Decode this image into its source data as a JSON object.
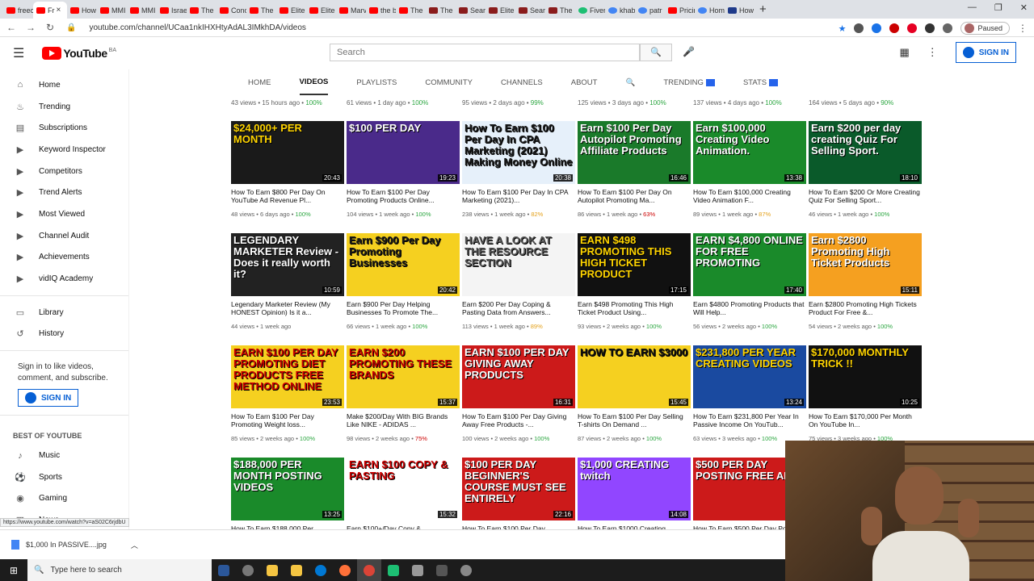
{
  "browser": {
    "tabs": [
      {
        "label": "freec",
        "icon": "youtube-icon",
        "active": false
      },
      {
        "label": "Fr",
        "icon": "youtube-icon",
        "active": true
      },
      {
        "label": "How",
        "icon": "youtube-icon",
        "active": false
      },
      {
        "label": "MMI",
        "icon": "youtube-icon",
        "active": false
      },
      {
        "label": "MMI",
        "icon": "youtube-icon",
        "active": false
      },
      {
        "label": "Israe",
        "icon": "youtube-icon",
        "active": false
      },
      {
        "label": "The",
        "icon": "youtube-icon",
        "active": false
      },
      {
        "label": "Conc",
        "icon": "youtube-icon",
        "active": false
      },
      {
        "label": "The",
        "icon": "youtube-icon",
        "active": false
      },
      {
        "label": "Elite",
        "icon": "youtube-icon",
        "active": false
      },
      {
        "label": "Elite",
        "icon": "youtube-icon",
        "active": false
      },
      {
        "label": "Marv",
        "icon": "youtube-icon",
        "active": false
      },
      {
        "label": "the b",
        "icon": "youtube-icon",
        "active": false
      },
      {
        "label": "The",
        "icon": "youtube-icon",
        "active": false
      },
      {
        "label": "The",
        "icon": "dk-icon",
        "active": false
      },
      {
        "label": "Sear",
        "icon": "dk-icon",
        "active": false
      },
      {
        "label": "Elite",
        "icon": "dk-icon",
        "active": false
      },
      {
        "label": "Sear",
        "icon": "dk-icon",
        "active": false
      },
      {
        "label": "The",
        "icon": "dk-icon",
        "active": false
      },
      {
        "label": "Fiver",
        "icon": "fiverr-icon",
        "active": false
      },
      {
        "label": "khab",
        "icon": "google-icon",
        "active": false
      },
      {
        "label": "patr",
        "icon": "google-icon",
        "active": false
      },
      {
        "label": "Pricin",
        "icon": "youtube-icon",
        "active": false
      },
      {
        "label": "Hom",
        "icon": "google-icon",
        "active": false
      },
      {
        "label": "How",
        "icon": "vidiq-icon",
        "active": false
      }
    ],
    "new_tab": "+",
    "url": "youtube.com/channel/UCaa1nkIHXHtyAdAL3IMkhDA/videos",
    "paused_label": "Paused"
  },
  "youtube": {
    "logo_text": "YouTube",
    "logo_region": "BA",
    "search_placeholder": "Search",
    "signin_label": "SIGN IN"
  },
  "sidebar": {
    "items": [
      {
        "label": "Home",
        "icon": "home-icon"
      },
      {
        "label": "Trending",
        "icon": "flame-icon"
      },
      {
        "label": "Subscriptions",
        "icon": "subscriptions-icon"
      },
      {
        "label": "Keyword Inspector",
        "icon": "vidiq-icon"
      },
      {
        "label": "Competitors",
        "icon": "vidiq-icon"
      },
      {
        "label": "Trend Alerts",
        "icon": "vidiq-icon"
      },
      {
        "label": "Most Viewed",
        "icon": "vidiq-icon"
      },
      {
        "label": "Channel Audit",
        "icon": "vidiq-icon"
      },
      {
        "label": "Achievements",
        "icon": "vidiq-icon"
      },
      {
        "label": "vidIQ Academy",
        "icon": "vidiq-icon"
      }
    ],
    "library": [
      {
        "label": "Library",
        "icon": "library-icon"
      },
      {
        "label": "History",
        "icon": "history-icon"
      }
    ],
    "signin_text": "Sign in to like videos, comment, and subscribe.",
    "signin_label": "SIGN IN",
    "best_heading": "BEST OF YOUTUBE",
    "best": [
      {
        "label": "Music",
        "icon": "music-icon"
      },
      {
        "label": "Sports",
        "icon": "sports-icon"
      },
      {
        "label": "Gaming",
        "icon": "gaming-icon"
      },
      {
        "label": "News",
        "icon": "news-icon"
      }
    ]
  },
  "channel_tabs": [
    {
      "label": "HOME",
      "active": false
    },
    {
      "label": "VIDEOS",
      "active": true
    },
    {
      "label": "PLAYLISTS",
      "active": false
    },
    {
      "label": "COMMUNITY",
      "active": false
    },
    {
      "label": "CHANNELS",
      "active": false
    },
    {
      "label": "ABOUT",
      "active": false
    },
    {
      "label": "TRENDING",
      "active": false,
      "badge": true
    },
    {
      "label": "STATS",
      "active": false,
      "badge": true
    }
  ],
  "top_meta": [
    {
      "views": "43 views",
      "age": "15 hours ago",
      "score": "100%",
      "level": "good"
    },
    {
      "views": "61 views",
      "age": "1 day ago",
      "score": "100%",
      "level": "good"
    },
    {
      "views": "95 views",
      "age": "2 days ago",
      "score": "99%",
      "level": "good"
    },
    {
      "views": "125 views",
      "age": "3 days ago",
      "score": "100%",
      "level": "good"
    },
    {
      "views": "137 views",
      "age": "4 days ago",
      "score": "100%",
      "level": "good"
    },
    {
      "views": "164 views",
      "age": "5 days ago",
      "score": "90%",
      "level": "good"
    }
  ],
  "videos": [
    {
      "thumb_text": "$24,000+ PER MONTH",
      "bg": "#1a1a1a",
      "fg": "#ffd400",
      "duration": "20:43",
      "title": "How To Earn $800 Per Day On YouTube Ad Revenue Pl...",
      "views": "48 views",
      "age": "6 days ago",
      "score": "100%",
      "level": "good"
    },
    {
      "thumb_text": "$100 PER DAY",
      "bg": "#4a2a8a",
      "fg": "#ffffff",
      "duration": "19:23",
      "title": "How To Earn $100 Per Day Promoting Products Online...",
      "views": "104 views",
      "age": "1 week ago",
      "score": "100%",
      "level": "good"
    },
    {
      "thumb_text": "How To Earn $100 Per Day In CPA Marketing (2021) Making Money Online",
      "bg": "#e6f0fa",
      "fg": "#1a1a1a",
      "duration": "20:38",
      "title": "How To Earn $100 Per Day In CPA Marketing (2021)...",
      "views": "238 views",
      "age": "1 week ago",
      "score": "82%",
      "level": "warn"
    },
    {
      "thumb_text": "Earn $100 Per Day Autopilot Promoting Affiliate Products",
      "bg": "#1a7a2a",
      "fg": "#ffffff",
      "duration": "16:46",
      "title": "How To Earn $100 Per Day On Autopilot Promoting Ma...",
      "views": "86 views",
      "age": "1 week ago",
      "score": "63%",
      "level": "bad"
    },
    {
      "thumb_text": "Earn $100,000 Creating Video Animation.",
      "bg": "#1a8a2a",
      "fg": "#ffffff",
      "duration": "13:38",
      "title": "How To Earn $100,000 Creating Video Animation F...",
      "views": "89 views",
      "age": "1 week ago",
      "score": "87%",
      "level": "warn"
    },
    {
      "thumb_text": "Earn $200 per day creating Quiz For Selling Sport.",
      "bg": "#0a5a2a",
      "fg": "#ffffff",
      "duration": "18:10",
      "title": "How To Earn $200 Or More Creating Quiz For Selling Sport...",
      "views": "46 views",
      "age": "1 week ago",
      "score": "100%",
      "level": "good"
    },
    {
      "thumb_text": "LEGENDARY MARKETER Review - Does it really worth it?",
      "bg": "#222222",
      "fg": "#ffffff",
      "duration": "10:59",
      "title": "Legendary Marketer Review (My HONEST Opinion) Is it a...",
      "views": "44 views",
      "age": "1 week ago",
      "score": "",
      "level": "good"
    },
    {
      "thumb_text": "Earn $900 Per Day Promoting Businesses",
      "bg": "#f5d020",
      "fg": "#1a1a1a",
      "duration": "20:42",
      "title": "Earn $900 Per Day Helping Businesses To Promote The...",
      "views": "66 views",
      "age": "1 week ago",
      "score": "100%",
      "level": "good"
    },
    {
      "thumb_text": "HAVE A LOOK AT THE RESOURCE SECTION",
      "bg": "#f4f4f4",
      "fg": "#555555",
      "duration": "",
      "title": "Earn $200 Per Day Coping & Pasting Data from Answers...",
      "views": "113 views",
      "age": "1 week ago",
      "score": "89%",
      "level": "warn"
    },
    {
      "thumb_text": "EARN $498 PROMOTING THIS HIGH TICKET PRODUCT",
      "bg": "#111111",
      "fg": "#ffd400",
      "duration": "17:15",
      "title": "Earn $498 Promoting This High Ticket Product Using...",
      "views": "93 views",
      "age": "2 weeks ago",
      "score": "100%",
      "level": "good"
    },
    {
      "thumb_text": "EARN $4,800 ONLINE FOR FREE PROMOTING",
      "bg": "#1a8a2a",
      "fg": "#ffffff",
      "duration": "17:40",
      "title": "Earn $4800 Promoting Products that Will Help...",
      "views": "56 views",
      "age": "2 weeks ago",
      "score": "100%",
      "level": "good"
    },
    {
      "thumb_text": "Earn $2800 Promoting High Ticket Products",
      "bg": "#f5a020",
      "fg": "#ffffff",
      "duration": "15:11",
      "title": "Earn $2800 Promoting High Tickets Product For Free &...",
      "views": "54 views",
      "age": "2 weeks ago",
      "score": "100%",
      "level": "good"
    },
    {
      "thumb_text": "EARN $100 PER DAY PROMOTING DIET PRODUCTS FREE METHOD ONLINE",
      "bg": "#f5d020",
      "fg": "#cc0000",
      "duration": "23:53",
      "title": "How To Earn $100 Per Day Promoting Weight loss...",
      "views": "85 views",
      "age": "2 weeks ago",
      "score": "100%",
      "level": "good"
    },
    {
      "thumb_text": "EARN $200 PROMOTING THESE BRANDS",
      "bg": "#f5d020",
      "fg": "#cc0000",
      "duration": "15:37",
      "title": "Make $200/Day With BIG Brands Like NIKE - ADIDAS ...",
      "views": "98 views",
      "age": "2 weeks ago",
      "score": "75%",
      "level": "bad"
    },
    {
      "thumb_text": "EARN $100 PER DAY GIVING AWAY PRODUCTS",
      "bg": "#cc1a1a",
      "fg": "#ffffff",
      "duration": "16:31",
      "title": "How To Earn $100 Per Day Giving Away Free Products -...",
      "views": "100 views",
      "age": "2 weeks ago",
      "score": "100%",
      "level": "good"
    },
    {
      "thumb_text": "HOW TO EARN $3000",
      "bg": "#f5d020",
      "fg": "#111111",
      "duration": "15:45",
      "title": "How To Earn $100 Per Day Selling T-shirts On Demand ...",
      "views": "87 views",
      "age": "2 weeks ago",
      "score": "100%",
      "level": "good"
    },
    {
      "thumb_text": "$231,800 PER YEAR CREATING VIDEOS",
      "bg": "#1a4aa0",
      "fg": "#ffd400",
      "duration": "13:24",
      "title": "How To Earn $231,800 Per Year In Passive Income On YouTub...",
      "views": "63 views",
      "age": "3 weeks ago",
      "score": "100%",
      "level": "good"
    },
    {
      "thumb_text": "$170,000 MONTHLY TRICK !!",
      "bg": "#111111",
      "fg": "#ffd400",
      "duration": "10:25",
      "title": "How To Earn $170,000 Per Month On YouTube In...",
      "views": "75 views",
      "age": "3 weeks ago",
      "score": "100%",
      "level": "good"
    },
    {
      "thumb_text": "$188,000 PER MONTH POSTING VIDEOS",
      "bg": "#1a8a2a",
      "fg": "#ffffff",
      "duration": "13:25",
      "title": "How To Earn $188,000 Per",
      "views": "",
      "age": "",
      "score": "",
      "level": "good"
    },
    {
      "thumb_text": "EARN $100 COPY & PASTING",
      "bg": "#ffffff",
      "fg": "#cc0000",
      "duration": "15:32",
      "title": "Earn $100+/Day Copy &",
      "views": "",
      "age": "",
      "score": "",
      "level": "good"
    },
    {
      "thumb_text": "$100 PER DAY BEGINNER'S COURSE MUST SEE ENTIRELY",
      "bg": "#cc1a1a",
      "fg": "#ffffff",
      "duration": "22:16",
      "title": "How To Earn $100 Per Day",
      "views": "",
      "age": "",
      "score": "",
      "level": "good"
    },
    {
      "thumb_text": "$1,000 CREATING twitch",
      "bg": "#9146ff",
      "fg": "#ffffff",
      "duration": "14:08",
      "title": "How To Earn $1000 Creating",
      "views": "",
      "age": "",
      "score": "",
      "level": "good"
    },
    {
      "thumb_text": "$500 PER DAY POSTING FREE ADS",
      "bg": "#cc1a1a",
      "fg": "#ffffff",
      "duration": "",
      "title": "How To Earn $500 Per Day Posting",
      "views": "",
      "age": "",
      "score": "",
      "level": "good"
    }
  ],
  "status_url": "https://www.youtube.com/watch?v=aS02C6rjdbU",
  "download": {
    "filename": "$1,000 In PASSIVE....jpg"
  },
  "taskbar": {
    "search_placeholder": "Type here to search"
  },
  "colors": {
    "accent": "#065fd4",
    "youtube_red": "#ff0000",
    "good": "#2ba640",
    "warn": "#e4a11b",
    "bad": "#cc0000"
  }
}
